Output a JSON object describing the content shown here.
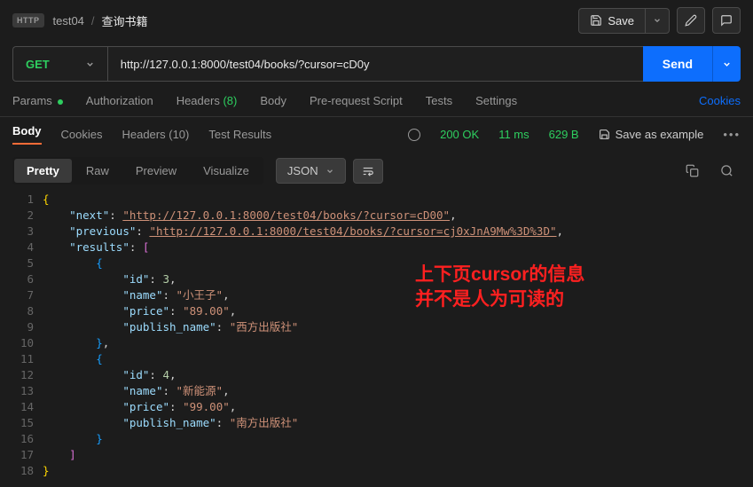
{
  "breadcrumb": {
    "badge": "HTTP",
    "parent": "test04",
    "current": "查询书籍"
  },
  "header": {
    "save": "Save"
  },
  "request": {
    "method": "GET",
    "url": "http://127.0.0.1:8000/test04/books/?cursor=cD0y",
    "send": "Send"
  },
  "reqTabs": {
    "params": "Params",
    "auth": "Authorization",
    "headers": "Headers",
    "headers_count": "(8)",
    "body": "Body",
    "prereq": "Pre-request Script",
    "tests": "Tests",
    "settings": "Settings",
    "cookies": "Cookies"
  },
  "respTabs": {
    "body": "Body",
    "cookies": "Cookies",
    "headers": "Headers",
    "headers_count": "(10)",
    "test_results": "Test Results"
  },
  "status": {
    "code": "200 OK",
    "time": "11 ms",
    "size": "629 B",
    "save_example": "Save as example"
  },
  "fmt": {
    "pretty": "Pretty",
    "raw": "Raw",
    "preview": "Preview",
    "visualize": "Visualize",
    "lang": "JSON"
  },
  "json": {
    "next_key": "\"next\"",
    "next_val": "\"http://127.0.0.1:8000/test04/books/?cursor=cD00\"",
    "prev_key": "\"previous\"",
    "prev_val": "\"http://127.0.0.1:8000/test04/books/?cursor=cj0xJnA9Mw%3D%3D\"",
    "results_key": "\"results\"",
    "r1_id_k": "\"id\"",
    "r1_id_v": "3",
    "r1_name_k": "\"name\"",
    "r1_name_v": "\"小王子\"",
    "r1_price_k": "\"price\"",
    "r1_price_v": "\"89.00\"",
    "r1_pub_k": "\"publish_name\"",
    "r1_pub_v": "\"西方出版社\"",
    "r2_id_k": "\"id\"",
    "r2_id_v": "4",
    "r2_name_k": "\"name\"",
    "r2_name_v": "\"新能源\"",
    "r2_price_k": "\"price\"",
    "r2_price_v": "\"99.00\"",
    "r2_pub_k": "\"publish_name\"",
    "r2_pub_v": "\"南方出版社\""
  },
  "annotation": {
    "line1": "上下页cursor的信息",
    "line2": "并不是人为可读的"
  }
}
